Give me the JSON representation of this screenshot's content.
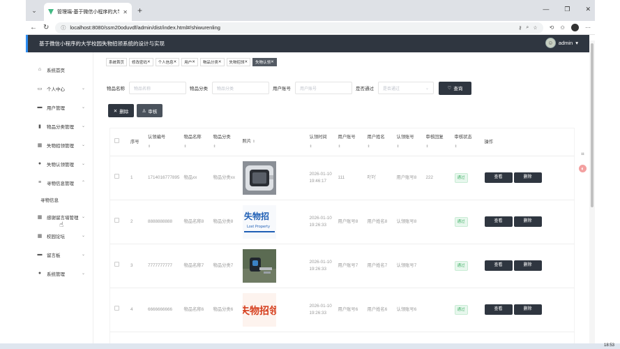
{
  "browser": {
    "tab_title": "管理端-基于微信小程序的大学校园",
    "url": "localhost:8080/ssm20oduvdf/admin/dist/index.html#/shiwurenling"
  },
  "app": {
    "title": "基于微信小程序的大学校园失物招领系统的设计与实现",
    "user": "admin"
  },
  "sidebar": {
    "items": [
      {
        "label": "系统首页",
        "icon": "home-icon"
      },
      {
        "label": "个人中心",
        "icon": "profile-icon"
      },
      {
        "label": "用户管理",
        "icon": "users-icon"
      },
      {
        "label": "物品分类管理",
        "icon": "category-icon"
      },
      {
        "label": "失物招领管理",
        "icon": "grid-icon"
      },
      {
        "label": "失物认领管理",
        "icon": "person-icon"
      },
      {
        "label": "寻物信息管理",
        "icon": "list-icon"
      },
      {
        "label": "感谢留言墙管理",
        "icon": "grid-icon"
      },
      {
        "label": "校园论坛",
        "icon": "grid-icon"
      },
      {
        "label": "留言板",
        "icon": "board-icon"
      },
      {
        "label": "系统管理",
        "icon": "person-icon"
      }
    ],
    "submenu": "寻物信息"
  },
  "tags": [
    "系统首页",
    "修改密码",
    "个人信息",
    "用户",
    "物品分类",
    "失物招领",
    "失物认领"
  ],
  "search": {
    "name_label": "物品名称",
    "name_placeholder": "物品名称",
    "cat_label": "物品分类",
    "cat_placeholder": "物品分类",
    "acct_label": "用户账号",
    "acct_placeholder": "用户账号",
    "pass_label": "是否通过",
    "pass_placeholder": "是否通过",
    "query_btn": "查询"
  },
  "actions": {
    "delete": "删除",
    "review": "审核"
  },
  "table": {
    "headers": [
      "序号",
      "认领编号",
      "物品名称",
      "物品分类",
      "照片",
      "认领时间",
      "用户账号",
      "用户姓名",
      "认领账号",
      "审核回复",
      "审核状态",
      "操作"
    ],
    "rows": [
      {
        "no": "1",
        "code": "1714016777895",
        "name": "物品xx",
        "cat": "物品分类xx",
        "time": "2026-01-10 19:46:17",
        "acct": "111",
        "uname": "吖吖",
        "racct": "用户账号8",
        "reply": "222",
        "status": "通过"
      },
      {
        "no": "2",
        "code": "8888888888",
        "name": "物品名称8",
        "cat": "物品分类8",
        "time": "2026-01-10 19:26:33",
        "acct": "用户账号8",
        "uname": "用户姓名8",
        "racct": "认领账号8",
        "reply": "",
        "status": "通过"
      },
      {
        "no": "3",
        "code": "7777777777",
        "name": "物品名称7",
        "cat": "物品分类7",
        "time": "2026-01-10 19:26:33",
        "acct": "用户账号7",
        "uname": "用户姓名7",
        "racct": "认领账号7",
        "reply": "",
        "status": "通过"
      },
      {
        "no": "4",
        "code": "6666666666",
        "name": "物品名称6",
        "cat": "物品分类6",
        "time": "2026-01-10 19:26:33",
        "acct": "用户账号6",
        "uname": "用户姓名6",
        "racct": "认领账号6",
        "reply": "",
        "status": "通过"
      }
    ],
    "view_btn": "查看",
    "del_btn": "删除"
  },
  "photo_text": {
    "lost_property_cn": "失物招",
    "lost_property_en": "Lost Property",
    "lost_cn_2": "失物招领"
  },
  "taskbar": {
    "time": "18:53"
  }
}
